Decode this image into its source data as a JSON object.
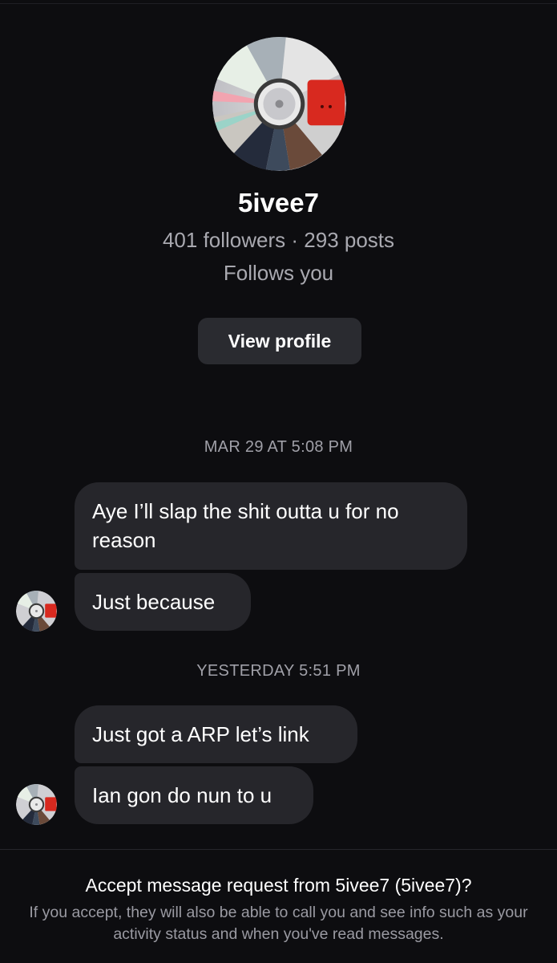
{
  "profile": {
    "name": "5ivee7",
    "stats": "401 followers · 293 posts",
    "follows_status": "Follows you",
    "view_profile_label": "View profile",
    "avatar": "album-cd-avatar"
  },
  "messages": [
    {
      "timestamp": "MAR 29 AT 5:08 PM"
    },
    {
      "text": "Aye I’ll slap the shit outta u for no reason"
    },
    {
      "text": "Just because"
    },
    {
      "timestamp": "YESTERDAY 5:51 PM"
    },
    {
      "text": "Just got a ARP let’s link"
    },
    {
      "text": "Ian gon do nun to u"
    }
  ],
  "request": {
    "title": "Accept message request from 5ivee7 (5ivee7)?",
    "info": "If you accept, they will also be able to call you and see info such as your activity status and when you've read messages."
  },
  "colors": {
    "background": "#0d0d10",
    "bubble": "#26262b",
    "button": "#2a2b30",
    "secondary_text": "#a9a9b0",
    "avatar_red": "#d8291f"
  }
}
